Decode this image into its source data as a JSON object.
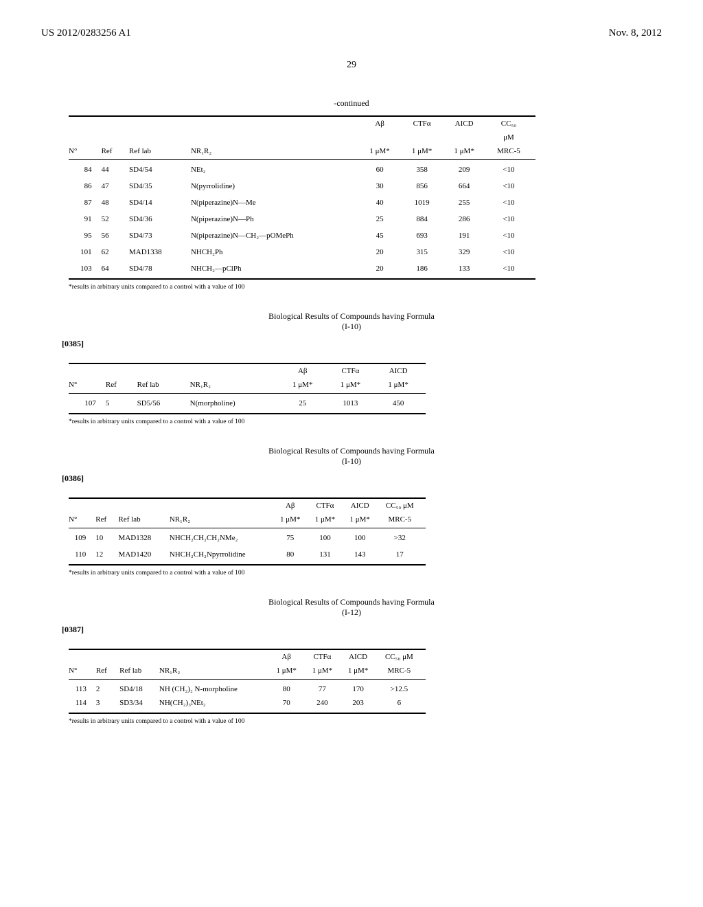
{
  "header": {
    "pub_number": "US 2012/0283256 A1",
    "pub_date": "Nov. 8, 2012"
  },
  "page_number": "29",
  "continued": "-continued",
  "footnote": "*results in arbitrary units compared to a control with a value of 100",
  "col_headers": {
    "n": "N°",
    "ref": "Ref",
    "reflab": "Ref lab",
    "nr1r2": "NR₁R₂",
    "ab": "Aβ",
    "ab_unit": "1 μM*",
    "ctfa": "CTFα",
    "ctfa_unit": "1 μM*",
    "aicd": "AICD",
    "aicd_unit": "1 μM*",
    "cc50_l1": "CC₅₀",
    "cc50_l2": "μM",
    "cc50_l3": "MRC-5",
    "cc50_b": "CC₅₀ μM",
    "cc50_b2": "MRC-5"
  },
  "table1": {
    "rows": [
      {
        "n": "84",
        "ref": "44",
        "reflab": "SD4/54",
        "nr": "NEt₂",
        "ab": "60",
        "ctfa": "358",
        "aicd": "209",
        "cc": "<10"
      },
      {
        "n": "86",
        "ref": "47",
        "reflab": "SD4/35",
        "nr": "N(pyrrolidine)",
        "ab": "30",
        "ctfa": "856",
        "aicd": "664",
        "cc": "<10"
      },
      {
        "n": "87",
        "ref": "48",
        "reflab": "SD4/14",
        "nr": "N(piperazine)N—Me",
        "ab": "40",
        "ctfa": "1019",
        "aicd": "255",
        "cc": "<10"
      },
      {
        "n": "91",
        "ref": "52",
        "reflab": "SD4/36",
        "nr": "N(piperazine)N—Ph",
        "ab": "25",
        "ctfa": "884",
        "aicd": "286",
        "cc": "<10"
      },
      {
        "n": "95",
        "ref": "56",
        "reflab": "SD4/73",
        "nr": "N(piperazine)N—CH₂—pOMePh",
        "ab": "45",
        "ctfa": "693",
        "aicd": "191",
        "cc": "<10"
      },
      {
        "n": "101",
        "ref": "62",
        "reflab": "MAD1338",
        "nr": "NHCH₂Ph",
        "ab": "20",
        "ctfa": "315",
        "aicd": "329",
        "cc": "<10"
      },
      {
        "n": "103",
        "ref": "64",
        "reflab": "SD4/78",
        "nr": "NHCH₂—pClPh",
        "ab": "20",
        "ctfa": "186",
        "aicd": "133",
        "cc": "<10"
      }
    ]
  },
  "section2": {
    "caption_l1": "Biological Results of Compounds having Formula",
    "caption_l2": "(I-10)",
    "paranum": "[0385]",
    "rows": [
      {
        "n": "107",
        "ref": "5",
        "reflab": "SD5/56",
        "nr": "N(morpholine)",
        "ab": "25",
        "ctfa": "1013",
        "aicd": "450"
      }
    ]
  },
  "section3": {
    "caption_l1": "Biological Results of Compounds having Formula",
    "caption_l2": "(I-10)",
    "paranum": "[0386]",
    "rows": [
      {
        "n": "109",
        "ref": "10",
        "reflab": "MAD1328",
        "nr": "NHCH₂CH₂CH₂NMe₂",
        "ab": "75",
        "ctfa": "100",
        "aicd": "100",
        "cc": ">32"
      },
      {
        "n": "110",
        "ref": "12",
        "reflab": "MAD1420",
        "nr": "NHCH₂CH₂Npyrrolidine",
        "ab": "80",
        "ctfa": "131",
        "aicd": "143",
        "cc": "17"
      }
    ]
  },
  "section4": {
    "caption_l1": "Biological Results of Compounds having Formula",
    "caption_l2": "(I-12)",
    "paranum": "[0387]",
    "rows": [
      {
        "n": "113",
        "ref": "2",
        "reflab": "SD4/18",
        "nr": "NH (CH₂)₂ N-morpholine",
        "ab": "80",
        "ctfa": "77",
        "aicd": "170",
        "cc": ">12.5"
      },
      {
        "n": "114",
        "ref": "3",
        "reflab": "SD3/34",
        "nr": "NH(CH₂)₃NEt₂",
        "ab": "70",
        "ctfa": "240",
        "aicd": "203",
        "cc": "6"
      }
    ]
  }
}
